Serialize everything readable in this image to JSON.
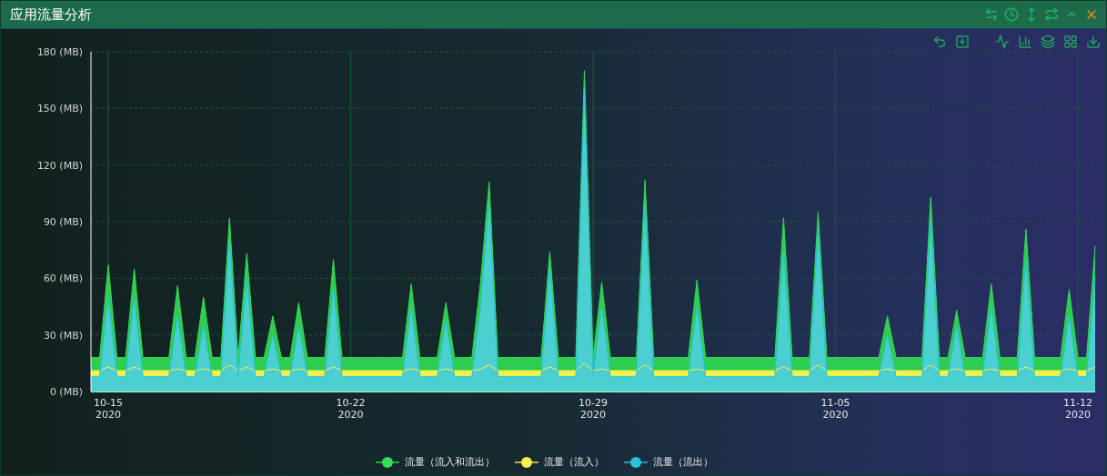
{
  "window": {
    "title": "应用流量分析"
  },
  "chart": {
    "chart_data": {
      "type": "area",
      "grid": true,
      "ylim": [
        0,
        180
      ],
      "yticks": [
        {
          "value": 0,
          "label": "0 (MB)"
        },
        {
          "value": 30,
          "label": "30 (MB)"
        },
        {
          "value": 60,
          "label": "60 (MB)"
        },
        {
          "value": 90,
          "label": "90 (MB)"
        },
        {
          "value": 120,
          "label": "120 (MB)"
        },
        {
          "value": 150,
          "label": "150 (MB)"
        },
        {
          "value": 180,
          "label": "180 (MB)"
        }
      ],
      "categories": [
        null,
        null,
        "10-15\n2020",
        null,
        null,
        null,
        null,
        null,
        null,
        null,
        null,
        null,
        null,
        null,
        null,
        null,
        null,
        null,
        null,
        null,
        null,
        null,
        null,
        null,
        null,
        null,
        null,
        null,
        null,
        null,
        "10-22\n2020",
        null,
        null,
        null,
        null,
        null,
        null,
        null,
        null,
        null,
        null,
        null,
        null,
        null,
        null,
        null,
        null,
        null,
        null,
        null,
        null,
        null,
        null,
        null,
        null,
        null,
        null,
        null,
        "10-29\n2020",
        null,
        null,
        null,
        null,
        null,
        null,
        null,
        null,
        null,
        null,
        null,
        null,
        null,
        null,
        null,
        null,
        null,
        null,
        null,
        null,
        null,
        null,
        null,
        null,
        null,
        null,
        null,
        "11-05\n2020",
        null,
        null,
        null,
        null,
        null,
        null,
        null,
        null,
        null,
        null,
        null,
        null,
        null,
        null,
        null,
        null,
        null,
        null,
        null,
        null,
        null,
        null,
        null,
        null,
        null,
        null,
        null,
        "11-12\n2020",
        null,
        null
      ],
      "series": [
        {
          "name": "流量（流入和流出）",
          "color": "#33dd55",
          "values": [
            18,
            18,
            67,
            18,
            18,
            65,
            18,
            18,
            18,
            18,
            56,
            18,
            18,
            50,
            18,
            18,
            92,
            18,
            73,
            18,
            18,
            40,
            18,
            18,
            47,
            18,
            18,
            18,
            70,
            18,
            18,
            18,
            18,
            18,
            18,
            18,
            18,
            57,
            18,
            18,
            18,
            47,
            18,
            18,
            18,
            58,
            111,
            18,
            18,
            18,
            18,
            18,
            18,
            74,
            18,
            18,
            18,
            170,
            18,
            58,
            18,
            18,
            18,
            18,
            112,
            18,
            18,
            18,
            18,
            18,
            59,
            18,
            18,
            18,
            18,
            18,
            18,
            18,
            18,
            18,
            92,
            18,
            18,
            18,
            95,
            18,
            18,
            18,
            18,
            18,
            18,
            18,
            40,
            18,
            18,
            18,
            18,
            103,
            18,
            18,
            43,
            18,
            18,
            18,
            57,
            18,
            18,
            18,
            86,
            18,
            18,
            18,
            18,
            54,
            18,
            18,
            77
          ]
        },
        {
          "name": "流量（流入）",
          "color": "#f5f04a",
          "values": [
            11,
            11,
            13,
            11,
            11,
            13,
            11,
            11,
            11,
            11,
            12,
            11,
            11,
            12,
            11,
            11,
            14,
            11,
            13,
            11,
            11,
            12,
            11,
            11,
            12,
            11,
            11,
            11,
            13,
            11,
            11,
            11,
            11,
            11,
            11,
            11,
            11,
            12,
            11,
            11,
            11,
            12,
            11,
            11,
            11,
            12,
            14,
            11,
            11,
            11,
            11,
            11,
            11,
            13,
            11,
            11,
            11,
            15,
            11,
            12,
            11,
            11,
            11,
            11,
            14,
            11,
            11,
            11,
            11,
            11,
            12,
            11,
            11,
            11,
            11,
            11,
            11,
            11,
            11,
            11,
            13,
            11,
            11,
            11,
            14,
            11,
            11,
            11,
            11,
            11,
            11,
            11,
            12,
            11,
            11,
            11,
            11,
            14,
            11,
            11,
            12,
            11,
            11,
            11,
            12,
            11,
            11,
            11,
            13,
            11,
            11,
            11,
            11,
            12,
            11,
            11,
            13
          ]
        },
        {
          "name": "流量（流出）",
          "color": "#2ac3de",
          "values": [
            8,
            8,
            50,
            8,
            8,
            50,
            8,
            8,
            8,
            8,
            40,
            8,
            8,
            35,
            8,
            8,
            80,
            8,
            60,
            8,
            8,
            30,
            8,
            8,
            35,
            8,
            8,
            8,
            55,
            8,
            8,
            8,
            8,
            8,
            8,
            8,
            8,
            45,
            8,
            8,
            8,
            38,
            8,
            8,
            8,
            45,
            100,
            8,
            8,
            8,
            8,
            8,
            8,
            65,
            8,
            8,
            8,
            160,
            8,
            45,
            8,
            8,
            8,
            8,
            100,
            8,
            8,
            8,
            8,
            8,
            45,
            8,
            8,
            8,
            8,
            8,
            8,
            8,
            8,
            8,
            75,
            8,
            8,
            8,
            85,
            8,
            8,
            8,
            8,
            8,
            8,
            8,
            30,
            8,
            8,
            8,
            8,
            90,
            8,
            8,
            35,
            8,
            8,
            8,
            45,
            8,
            8,
            8,
            70,
            8,
            8,
            8,
            8,
            40,
            8,
            8,
            60
          ]
        }
      ]
    }
  }
}
